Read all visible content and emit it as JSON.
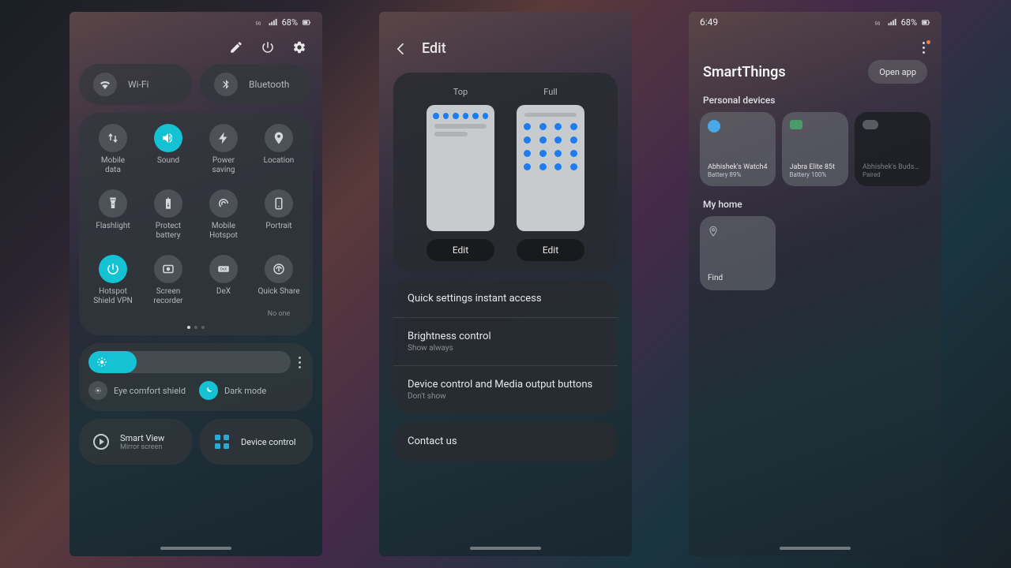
{
  "status": {
    "time": "6:49",
    "battery_pct": "68%"
  },
  "panel1": {
    "pills": {
      "wifi": "Wi-Fi",
      "bluetooth": "Bluetooth"
    },
    "tiles": [
      {
        "label": "Mobile\ndata",
        "on": false,
        "icon": "mobile-data"
      },
      {
        "label": "Sound",
        "on": true,
        "icon": "sound"
      },
      {
        "label": "Power\nsaving",
        "on": false,
        "icon": "power-saving"
      },
      {
        "label": "Location",
        "on": false,
        "icon": "location"
      },
      {
        "label": "Flashlight",
        "on": false,
        "icon": "flashlight"
      },
      {
        "label": "Protect\nbattery",
        "on": false,
        "icon": "protect-battery"
      },
      {
        "label": "Mobile\nHotspot",
        "on": false,
        "icon": "hotspot"
      },
      {
        "label": "Portrait",
        "on": false,
        "icon": "portrait"
      },
      {
        "label": "Hotspot\nShield VPN",
        "on": true,
        "icon": "vpn"
      },
      {
        "label": "Screen\nrecorder",
        "on": false,
        "icon": "screen-recorder"
      },
      {
        "label": "DeX",
        "on": false,
        "icon": "dex"
      },
      {
        "label": "Quick Share",
        "on": false,
        "icon": "quick-share",
        "sub": "No one"
      }
    ],
    "brightness_pct": 24,
    "eye_comfort": {
      "label": "Eye comfort shield",
      "on": false
    },
    "dark_mode": {
      "label": "Dark mode",
      "on": true
    },
    "smart_view": {
      "title": "Smart View",
      "sub": "Mirror screen"
    },
    "device_control": "Device control"
  },
  "panel2": {
    "title": "Edit",
    "layouts": {
      "top": "Top",
      "full": "Full",
      "edit_btn": "Edit"
    },
    "items": [
      {
        "title": "Quick settings instant access",
        "sub": ""
      },
      {
        "title": "Brightness control",
        "sub": "Show always"
      },
      {
        "title": "Device control and Media output buttons",
        "sub": "Don't show"
      }
    ],
    "contact": "Contact us"
  },
  "panel3": {
    "app_title": "SmartThings",
    "open_app": "Open app",
    "personal_label": "Personal devices",
    "devices": [
      {
        "name": "Abhishek's Watch4",
        "status": "Battery 89%",
        "tone": "light",
        "icon": "blue"
      },
      {
        "name": "Jabra Elite 85t",
        "status": "Battery 100%",
        "tone": "light",
        "icon": "green"
      },
      {
        "name": "Abhishek's Buds2 ...",
        "status": "Paired",
        "tone": "dark",
        "icon": "grey"
      }
    ],
    "myhome_label": "My home",
    "find": "Find"
  }
}
